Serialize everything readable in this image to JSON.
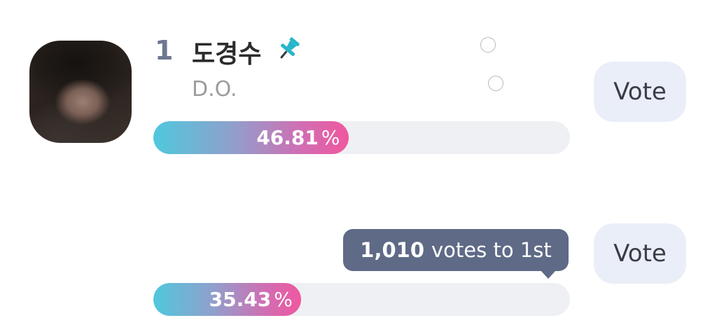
{
  "candidates": [
    {
      "rank": "1",
      "name": "도경수",
      "subname": "D.O.",
      "percent_value": "46.81",
      "percent_sign": "%",
      "share": 0.4681,
      "vote_label": "Vote",
      "pin_icon": "pin-icon"
    },
    {
      "percent_value": "35.43",
      "percent_sign": "%",
      "share": 0.3543,
      "vote_label": "Vote",
      "tooltip": {
        "count": "1,010",
        "text": "votes to 1st"
      }
    }
  ],
  "colors": {
    "bar_start": "#4fc8dd",
    "bar_end": "#f0579f",
    "track": "#eef0f3",
    "vote_button_bg": "#e9eef8",
    "tooltip_bg": "#5e6a86",
    "rank_color": "#6d7891"
  }
}
